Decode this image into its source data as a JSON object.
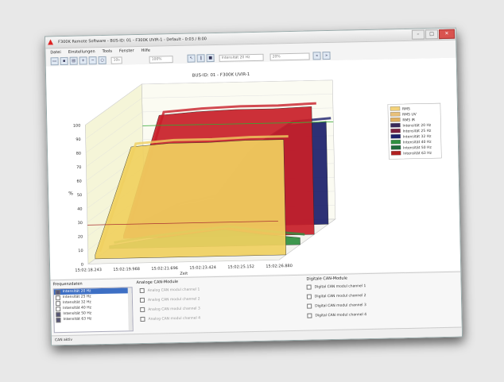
{
  "window": {
    "title": "F300K Remote Software - BUS-ID: 01 - F300K UVIR-1 - Default - 0:03 / 8:00",
    "app_icon": "app-logo-icon"
  },
  "menu": [
    "Datei",
    "Einstellungen",
    "Tools",
    "Fenster",
    "Hilfe"
  ],
  "toolbar": {
    "time_field": "10s",
    "zoom_field": "100%",
    "channel_select": "Intensität 20 Hz",
    "percent_field": "20%"
  },
  "chart_data": {
    "type": "area",
    "title": "BUS-ID: 01 - F300K UVIR-1",
    "xlabel": "Zeit",
    "ylabel": "%",
    "ylim": [
      0,
      100
    ],
    "yticks": [
      0,
      10,
      20,
      30,
      40,
      50,
      60,
      70,
      80,
      90,
      100
    ],
    "x": [
      "15:02:18.243",
      "15:02:19.968",
      "15:02:21.696",
      "15:02:23.424",
      "15:02:25.152",
      "15:02:26.880"
    ],
    "legend": [
      "RMS",
      "RMS UV",
      "RMS IR",
      "Intensität 20 Hz",
      "Intensität 25 Hz",
      "Intensität 32 Hz",
      "Intensität 40 Hz",
      "Intensität 50 Hz",
      "Intensität 63 Hz"
    ],
    "legend_colors": [
      "#f3d27a",
      "#e8c07a",
      "#e0b060",
      "#3a2a5a",
      "#7a2040",
      "#1b1f6a",
      "#2f8f3f",
      "#1f6a3a",
      "#b02020"
    ],
    "series": [
      {
        "name": "Intensität 20 Hz",
        "color": "#1b1f6a",
        "values": [
          2,
          15,
          20,
          55,
          72,
          74
        ]
      },
      {
        "name": "Intensität 63 Hz",
        "color": "#c81e28",
        "values": [
          2,
          88,
          90,
          91,
          91,
          92
        ]
      },
      {
        "name": "Intensität 40 Hz",
        "color": "#2f8f3f",
        "values": [
          2,
          6,
          9,
          12,
          8,
          5
        ]
      },
      {
        "name": "RMS",
        "color": "#f0d060",
        "values": [
          3,
          80,
          82,
          82,
          83,
          83
        ]
      }
    ],
    "grid": true
  },
  "panels": {
    "frequencies_title": "Frequenzdaten",
    "frequencies": [
      {
        "label": "Intensität 20 Hz",
        "checked": true,
        "selected": true
      },
      {
        "label": "Intensität 25 Hz",
        "checked": false,
        "selected": false
      },
      {
        "label": "Intensität 32 Hz",
        "checked": false,
        "selected": false
      },
      {
        "label": "Intensität 40 Hz",
        "checked": false,
        "selected": false
      },
      {
        "label": "Intensität 50 Hz",
        "checked": true,
        "selected": false
      },
      {
        "label": "Intensität 63 Hz",
        "checked": true,
        "selected": false
      }
    ],
    "analog_title": "Analoge CAN-Module",
    "analog": [
      "Analog CAN modul channel 1",
      "Analog CAN modul channel 2",
      "Analog CAN modul channel 3",
      "Analog CAN modul channel 4"
    ],
    "digital_title": "Digitale CAN-Module",
    "digital": [
      "Digital CAN modul channel 1",
      "Digital CAN modul channel 2",
      "Digital CAN modul channel 3",
      "Digital CAN modul channel 4"
    ]
  },
  "status": "CAN aktiv"
}
